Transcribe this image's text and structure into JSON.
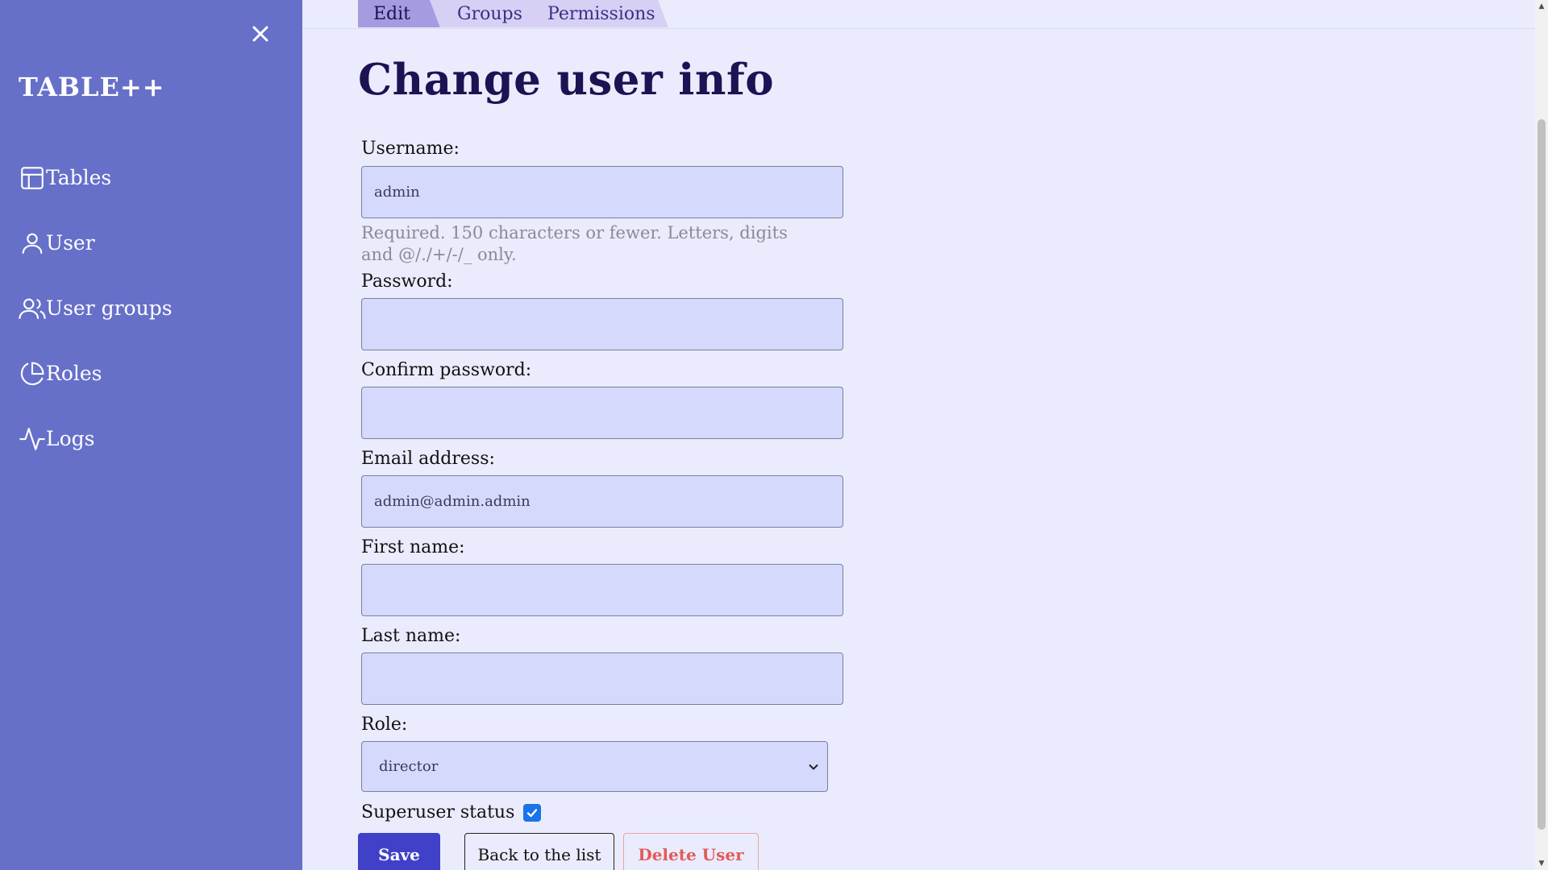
{
  "sidebar": {
    "logo": "TABLE++",
    "items": [
      {
        "label": "Tables",
        "icon": "table-icon"
      },
      {
        "label": "User",
        "icon": "user-icon"
      },
      {
        "label": "User groups",
        "icon": "users-icon"
      },
      {
        "label": "Roles",
        "icon": "pie-chart-icon"
      },
      {
        "label": "Logs",
        "icon": "activity-icon"
      }
    ],
    "colors": {
      "background": "#6670c9",
      "text": "#ffffff"
    }
  },
  "tabs": [
    {
      "label": "Edit",
      "active": true
    },
    {
      "label": "Groups",
      "active": false
    },
    {
      "label": "Permissions",
      "active": false
    }
  ],
  "page": {
    "title": "Change user info"
  },
  "form": {
    "username": {
      "label": "Username:",
      "value": "admin",
      "help": "Required. 150 characters or fewer. Letters, digits and @/./+/-/_ only."
    },
    "password": {
      "label": "Password:",
      "value": ""
    },
    "confirm_password": {
      "label": "Confirm password:",
      "value": ""
    },
    "email": {
      "label": "Email address:",
      "value": "admin@admin.admin"
    },
    "first_name": {
      "label": "First name:",
      "value": ""
    },
    "last_name": {
      "label": "Last name:",
      "value": ""
    },
    "role": {
      "label": "Role:",
      "selected": "director"
    },
    "superuser": {
      "label": "Superuser status",
      "checked": true
    }
  },
  "buttons": {
    "save": "Save",
    "back": "Back to the list",
    "delete": "Delete User"
  },
  "colors": {
    "page_background": "#eaecfd",
    "input_background": "#d5dafd",
    "title": "#1d1253",
    "primary": "#4040c8",
    "danger": "#e45a5a"
  }
}
